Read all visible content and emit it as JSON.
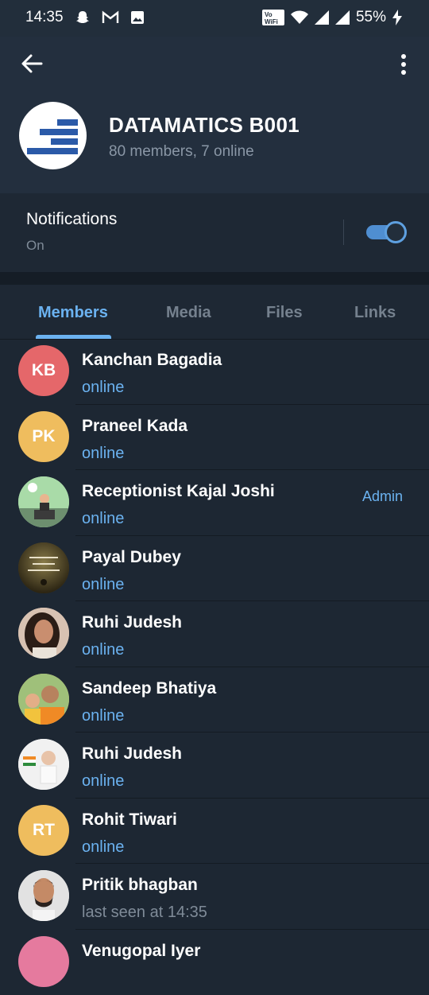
{
  "status_bar": {
    "time": "14:35",
    "battery": "55%",
    "icons": [
      "snapchat-icon",
      "gmail-icon",
      "gallery-icon",
      "vowifi-icon",
      "wifi-icon",
      "signal-icon",
      "signal-icon",
      "charging-icon"
    ],
    "network_label": "Vo WiFi"
  },
  "header": {
    "title": "DATAMATICS B001",
    "subtitle": "80 members, 7 online"
  },
  "notifications": {
    "label": "Notifications",
    "value": "On",
    "enabled": true
  },
  "tabs": [
    {
      "label": "Members",
      "active": true
    },
    {
      "label": "Media",
      "active": false
    },
    {
      "label": "Files",
      "active": false
    },
    {
      "label": "Links",
      "active": false
    }
  ],
  "members": [
    {
      "initials": "KB",
      "name": "Kanchan Bagadia",
      "status": "online",
      "role": "",
      "color": "#e5676a"
    },
    {
      "initials": "PK",
      "name": "Praneel Kada",
      "status": "online",
      "role": "",
      "color": "#efbd5e"
    },
    {
      "initials": "",
      "name": "Receptionist Kajal Joshi",
      "status": "online",
      "role": "Admin",
      "color": "#7fbf86"
    },
    {
      "initials": "",
      "name": "Payal Dubey",
      "status": "online",
      "role": "",
      "color": "#5a4a2a"
    },
    {
      "initials": "",
      "name": "Ruhi Judesh",
      "status": "online",
      "role": "",
      "color": "#c9a58f"
    },
    {
      "initials": "",
      "name": "Sandeep Bhatiya",
      "status": "online",
      "role": "",
      "color": "#d8a25d"
    },
    {
      "initials": "",
      "name": "Ruhi Judesh",
      "status": "online",
      "role": "",
      "color": "#e8e8e8"
    },
    {
      "initials": "RT",
      "name": "Rohit Tiwari",
      "status": "online",
      "role": "",
      "color": "#efbd5e"
    },
    {
      "initials": "",
      "name": "Pritik bhagban",
      "status": "last seen at 14:35",
      "role": "",
      "color": "#c7c7c7"
    },
    {
      "initials": "",
      "name": "Venugopal Iyer",
      "status": "",
      "role": "",
      "color": "#e57a9e"
    }
  ],
  "colors": {
    "accent": "#6bb2f0",
    "background": "#1d2733"
  }
}
